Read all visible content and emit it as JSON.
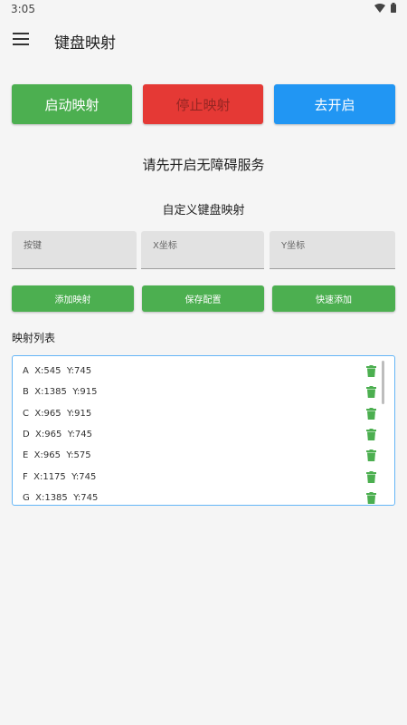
{
  "status_bar": {
    "time": "3:05"
  },
  "app_bar": {
    "title": "键盘映射"
  },
  "buttons": {
    "start": "启动映射",
    "stop": "停止映射",
    "open": "去开启"
  },
  "service_message": "请先开启无障碍服务",
  "section_title": "自定义键盘映射",
  "inputs": {
    "key_placeholder": "按键",
    "x_placeholder": "X坐标",
    "y_placeholder": "Y坐标"
  },
  "actions": {
    "add": "添加映射",
    "save": "保存配置",
    "quick": "快速添加"
  },
  "list_label": "映射列表",
  "mappings": [
    "A  X:545  Y:745",
    "B  X:1385  Y:915",
    "C  X:965  Y:915",
    "D  X:965  Y:745",
    "E  X:965  Y:575",
    "F  X:1175  Y:745",
    "G  X:1385  Y:745"
  ],
  "colors": {
    "green": "#4caf50",
    "red": "#e53935",
    "blue": "#2196f3"
  }
}
